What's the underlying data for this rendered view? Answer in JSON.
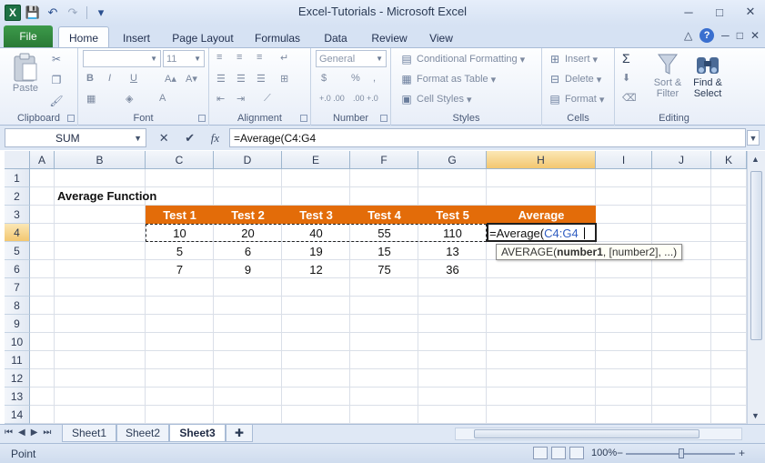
{
  "window": {
    "title": "Excel-Tutorials  -  Microsoft Excel",
    "minimize": "─",
    "restore": "□",
    "close": "✕"
  },
  "qat": {
    "app_icon": "X",
    "save": "💾",
    "undo": "↶",
    "redo": "↷",
    "customize": "▾"
  },
  "tabs": {
    "file": "File",
    "items": [
      "Home",
      "Insert",
      "Page Layout",
      "Formulas",
      "Data",
      "Review",
      "View"
    ],
    "active": "Home",
    "right": {
      "collapse": "△",
      "help": "?",
      "min": "─",
      "restore": "□",
      "close": "✕"
    }
  },
  "ribbon": {
    "clipboard": {
      "label": "Clipboard",
      "paste": "Paste"
    },
    "font": {
      "label": "Font",
      "font_name": "",
      "font_size": "11",
      "bold": "B",
      "italic": "I",
      "underline": "U",
      "grow": "A▴",
      "shrink": "A▾"
    },
    "alignment": {
      "label": "Alignment"
    },
    "number": {
      "label": "Number",
      "format": "General",
      "currency": "$",
      "percent": "%",
      "comma": ",",
      "inc_dec": "+.0 .00",
      "dec_dec": ".00 +.0"
    },
    "styles": {
      "label": "Styles",
      "conditional": "Conditional Formatting",
      "format_table": "Format as Table",
      "cell_styles": "Cell Styles"
    },
    "cells": {
      "label": "Cells",
      "insert": "Insert",
      "delete": "Delete",
      "format": "Format"
    },
    "editing": {
      "label": "Editing",
      "autosum": "Σ",
      "sort_filter_1": "Sort &",
      "sort_filter_2": "Filter",
      "find_select_1": "Find &",
      "find_select_2": "Select"
    }
  },
  "formula_bar": {
    "name_box": "SUM",
    "fx": "fx",
    "cancel": "✕",
    "enter": "✔",
    "formula": "=Average(C4:G4"
  },
  "grid": {
    "columns": [
      "A",
      "B",
      "C",
      "D",
      "E",
      "F",
      "G",
      "H",
      "I",
      "J",
      "K"
    ],
    "rows": [
      "1",
      "2",
      "3",
      "4",
      "5",
      "6",
      "7",
      "8",
      "9",
      "10",
      "11",
      "12",
      "13",
      "14"
    ],
    "selected_column": "H",
    "selected_row": "4",
    "title": "Average Function",
    "headers": [
      "Test 1",
      "Test 2",
      "Test 3",
      "Test 4",
      "Test 5",
      "Average"
    ],
    "data": [
      [
        "10",
        "20",
        "40",
        "55",
        "110"
      ],
      [
        "5",
        "6",
        "19",
        "15",
        "13"
      ],
      [
        "7",
        "9",
        "12",
        "75",
        "36"
      ]
    ],
    "active_cell_text_prefix": "=Average(",
    "active_cell_ref": "C4:G4",
    "tooltip_fn": "AVERAGE(",
    "tooltip_arg1": "number1",
    "tooltip_rest": ", [number2], ...)",
    "header_color": "#e36c09"
  },
  "sheets": {
    "items": [
      "Sheet1",
      "Sheet2",
      "Sheet3"
    ],
    "active": "Sheet3",
    "nav": [
      "⏮",
      "◀",
      "▶",
      "⏭"
    ]
  },
  "status": {
    "mode": "Point",
    "zoom": "100%",
    "minus": "−",
    "plus": "+"
  }
}
